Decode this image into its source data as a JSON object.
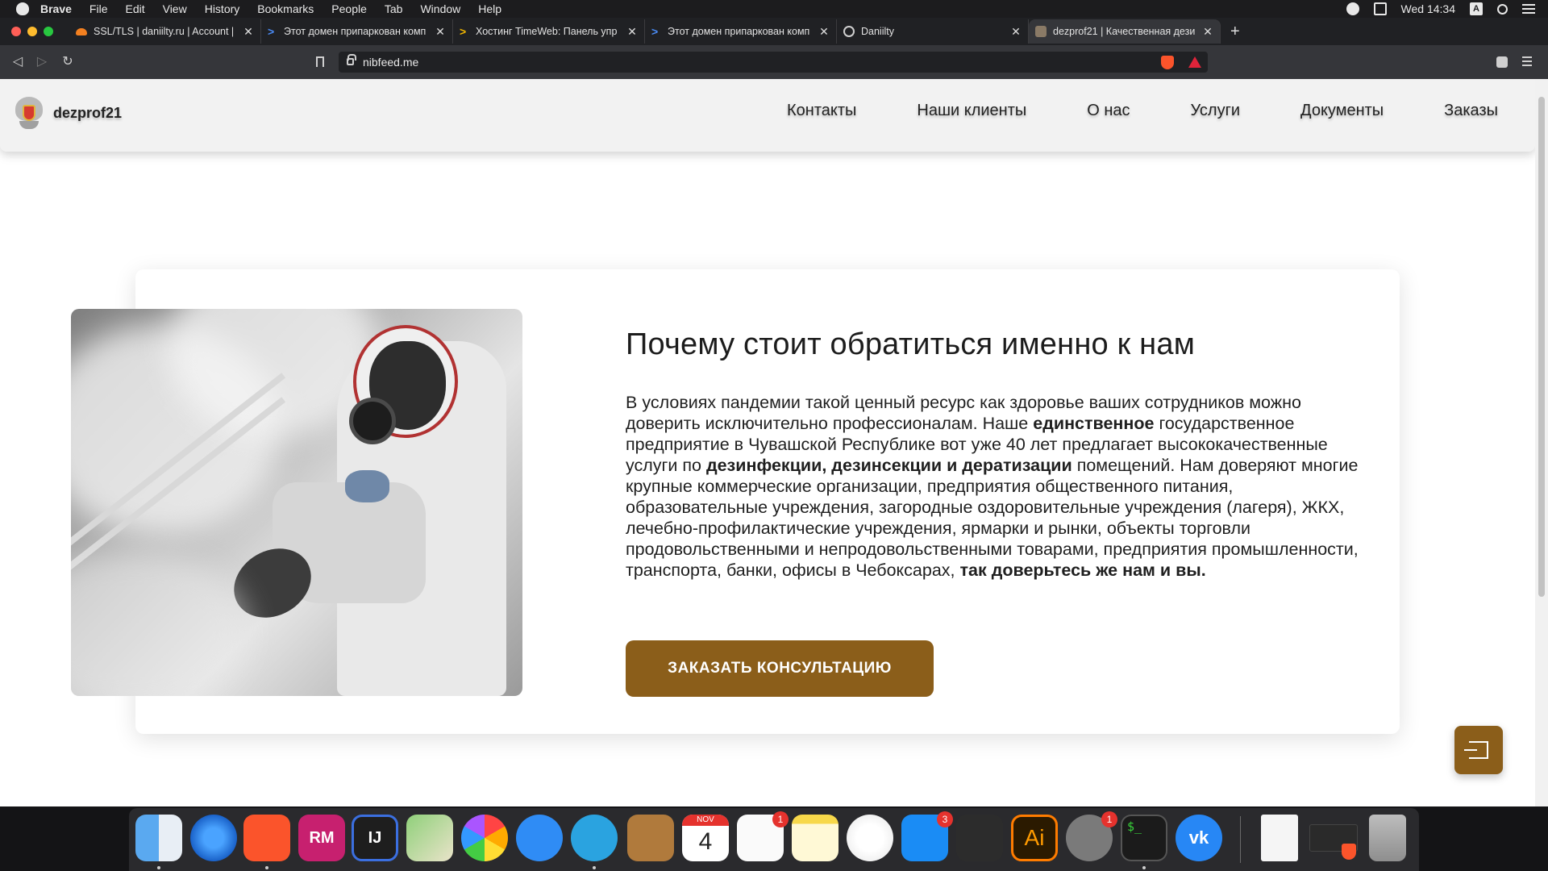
{
  "menubar": {
    "app": "Brave",
    "items": [
      "File",
      "Edit",
      "View",
      "History",
      "Bookmarks",
      "People",
      "Tab",
      "Window",
      "Help"
    ],
    "clock": "Wed 14:34",
    "input_source": "A"
  },
  "tabs": [
    {
      "title": "SSL/TLS | daniilty.ru | Account |",
      "icon": "cloudflare-icon"
    },
    {
      "title": "Этот домен припаркован комп",
      "icon": "chevron-icon"
    },
    {
      "title": "Хостинг TimeWeb: Панель упр",
      "icon": "chevron-icon"
    },
    {
      "title": "Этот домен припаркован комп",
      "icon": "chevron-icon"
    },
    {
      "title": "Daniilty",
      "icon": "globe-icon"
    },
    {
      "title": "dezprof21 | Качественная дези",
      "icon": "emblem-icon"
    }
  ],
  "toolbar": {
    "url": "nibfeed.me"
  },
  "site": {
    "logo": "dezprof21",
    "nav": [
      "Контакты",
      "Наши клиенты",
      "О нас",
      "Услуги",
      "Документы",
      "Заказы"
    ],
    "heading": "Почему стоит обратиться именно к нам",
    "paragraph": {
      "p1": "В условиях пандемии такой ценный ресурс как здоровье ваших сотрудников можно доверить исключительно профессионалам. Наше ",
      "b1": "единственное",
      "p2": " государственное предприятие в Чувашской Республике вот уже 40 лет предлагает высококачественные услуги по ",
      "b2": "дезинфекции, дезинсекции и дератизации",
      "p3": " помещений. Нам доверяют многие крупные коммерческие организации, предприятия общественного питания, образовательные учреждения, загородные оздоровительные учреждения (лагеря), ЖКХ, лечебно-профилактические учреждения, ярмарки и рынки, объекты торговли продовольственными и непродовольственными товарами, предприятия промышленности, транспорта, банки, офисы в Чебоксарах, ",
      "b3": "так доверьтесь же нам и вы."
    },
    "cta": "ЗАКАЗАТЬ КОНСУЛЬТАЦИЮ",
    "accent_color": "#8b5e1a"
  },
  "dock": {
    "calendar_month": "NOV",
    "calendar_day": "4",
    "badges": {
      "reminders": "1",
      "appstore": "3",
      "preferences": "1"
    },
    "terminal_prompt": "$_",
    "illustrator_label": "Ai",
    "rubymine_label": "RM",
    "intellij_label": "IJ"
  }
}
